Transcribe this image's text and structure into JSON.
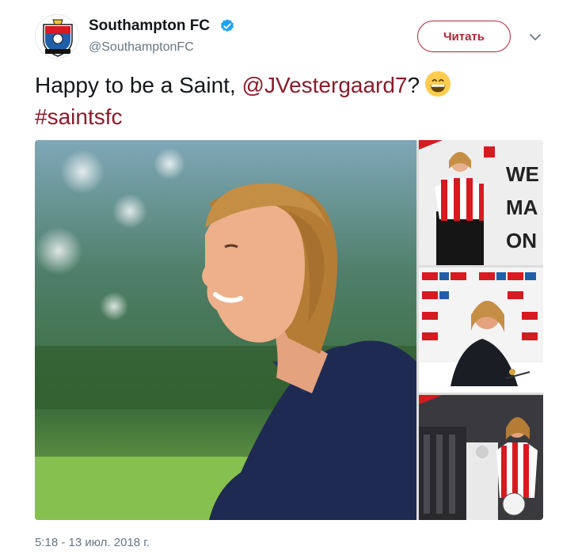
{
  "account": {
    "name": "Southampton FC",
    "handle": "@SouthamptonFC",
    "avatar_icon": "southampton-crest-icon",
    "verified_icon": "verified-badge-icon"
  },
  "follow_button": {
    "label": "Читать"
  },
  "menu_icon": "chevron-down-icon",
  "tweet": {
    "text_prefix": "Happy to be a Saint, ",
    "mention": "@JVestergaard7",
    "text_suffix": "?",
    "emoji_icon": "grinning-face-emoji-icon",
    "hashtag": "#saintsfc"
  },
  "media": {
    "photo3_sign_lines": [
      "WE",
      "MA",
      "ON"
    ]
  },
  "timestamp": "5:18 - 13 июл. 2018 г.",
  "colors": {
    "brand_red": "#d71920",
    "link": "#8a1c2a",
    "secondary_text": "#657786",
    "verified_blue": "#1da1f2"
  }
}
